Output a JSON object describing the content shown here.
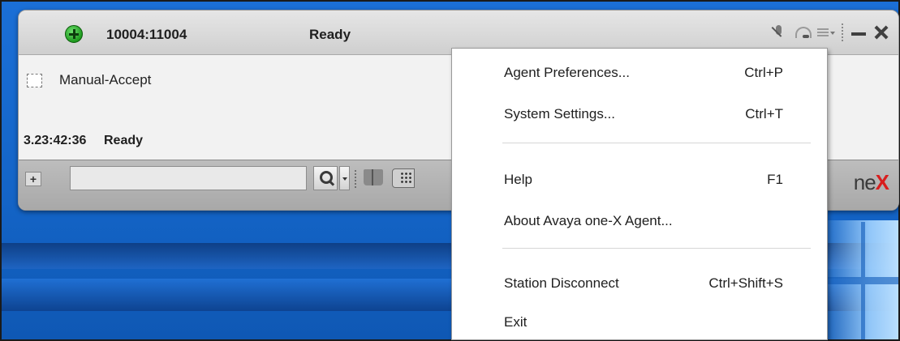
{
  "window": {
    "extension": "10004:11004",
    "state": "Ready"
  },
  "body": {
    "manual_accept_label": "Manual-Accept",
    "timer": "3.23:42:36",
    "timer_state": "Ready"
  },
  "toolbar": {
    "dial_value": "",
    "brand_prefix": "ne",
    "brand_x": "X"
  },
  "menu": {
    "items": [
      {
        "label": "Agent Preferences...",
        "shortcut": "Ctrl+P"
      },
      {
        "label": "System Settings...",
        "shortcut": "Ctrl+T"
      },
      {
        "label": "Help",
        "shortcut": "F1"
      },
      {
        "label": "About Avaya one-X Agent...",
        "shortcut": ""
      },
      {
        "label": "Station Disconnect",
        "shortcut": "Ctrl+Shift+S"
      },
      {
        "label": "Exit",
        "shortcut": ""
      }
    ]
  },
  "colors": {
    "status_green": "#1e9a1e",
    "brand_red": "#d81e1e",
    "desktop_blue": "#1465c8"
  },
  "icons": [
    "add-status-icon",
    "mic-mute-icon",
    "headset-icon",
    "menu-icon",
    "minimize-icon",
    "close-icon",
    "search-icon",
    "book-icon",
    "dialpad-icon"
  ]
}
